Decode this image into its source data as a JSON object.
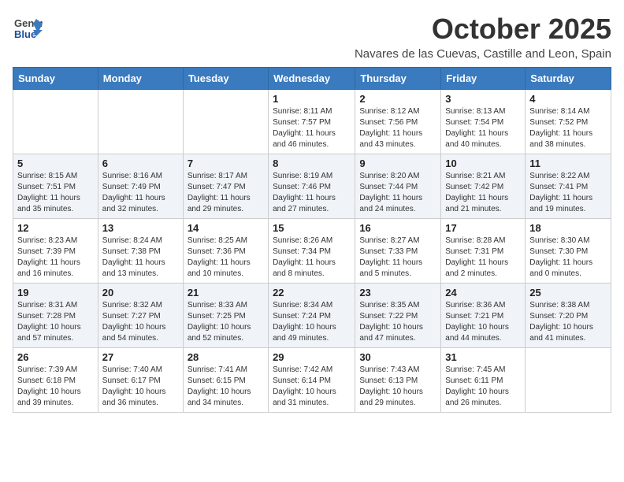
{
  "logo": {
    "general": "General",
    "blue": "Blue"
  },
  "title": "October 2025",
  "subtitle": "Navares de las Cuevas, Castille and Leon, Spain",
  "headers": [
    "Sunday",
    "Monday",
    "Tuesday",
    "Wednesday",
    "Thursday",
    "Friday",
    "Saturday"
  ],
  "weeks": [
    [
      {
        "day": "",
        "info": ""
      },
      {
        "day": "",
        "info": ""
      },
      {
        "day": "",
        "info": ""
      },
      {
        "day": "1",
        "info": "Sunrise: 8:11 AM\nSunset: 7:57 PM\nDaylight: 11 hours and 46 minutes."
      },
      {
        "day": "2",
        "info": "Sunrise: 8:12 AM\nSunset: 7:56 PM\nDaylight: 11 hours and 43 minutes."
      },
      {
        "day": "3",
        "info": "Sunrise: 8:13 AM\nSunset: 7:54 PM\nDaylight: 11 hours and 40 minutes."
      },
      {
        "day": "4",
        "info": "Sunrise: 8:14 AM\nSunset: 7:52 PM\nDaylight: 11 hours and 38 minutes."
      }
    ],
    [
      {
        "day": "5",
        "info": "Sunrise: 8:15 AM\nSunset: 7:51 PM\nDaylight: 11 hours and 35 minutes."
      },
      {
        "day": "6",
        "info": "Sunrise: 8:16 AM\nSunset: 7:49 PM\nDaylight: 11 hours and 32 minutes."
      },
      {
        "day": "7",
        "info": "Sunrise: 8:17 AM\nSunset: 7:47 PM\nDaylight: 11 hours and 29 minutes."
      },
      {
        "day": "8",
        "info": "Sunrise: 8:19 AM\nSunset: 7:46 PM\nDaylight: 11 hours and 27 minutes."
      },
      {
        "day": "9",
        "info": "Sunrise: 8:20 AM\nSunset: 7:44 PM\nDaylight: 11 hours and 24 minutes."
      },
      {
        "day": "10",
        "info": "Sunrise: 8:21 AM\nSunset: 7:42 PM\nDaylight: 11 hours and 21 minutes."
      },
      {
        "day": "11",
        "info": "Sunrise: 8:22 AM\nSunset: 7:41 PM\nDaylight: 11 hours and 19 minutes."
      }
    ],
    [
      {
        "day": "12",
        "info": "Sunrise: 8:23 AM\nSunset: 7:39 PM\nDaylight: 11 hours and 16 minutes."
      },
      {
        "day": "13",
        "info": "Sunrise: 8:24 AM\nSunset: 7:38 PM\nDaylight: 11 hours and 13 minutes."
      },
      {
        "day": "14",
        "info": "Sunrise: 8:25 AM\nSunset: 7:36 PM\nDaylight: 11 hours and 10 minutes."
      },
      {
        "day": "15",
        "info": "Sunrise: 8:26 AM\nSunset: 7:34 PM\nDaylight: 11 hours and 8 minutes."
      },
      {
        "day": "16",
        "info": "Sunrise: 8:27 AM\nSunset: 7:33 PM\nDaylight: 11 hours and 5 minutes."
      },
      {
        "day": "17",
        "info": "Sunrise: 8:28 AM\nSunset: 7:31 PM\nDaylight: 11 hours and 2 minutes."
      },
      {
        "day": "18",
        "info": "Sunrise: 8:30 AM\nSunset: 7:30 PM\nDaylight: 11 hours and 0 minutes."
      }
    ],
    [
      {
        "day": "19",
        "info": "Sunrise: 8:31 AM\nSunset: 7:28 PM\nDaylight: 10 hours and 57 minutes."
      },
      {
        "day": "20",
        "info": "Sunrise: 8:32 AM\nSunset: 7:27 PM\nDaylight: 10 hours and 54 minutes."
      },
      {
        "day": "21",
        "info": "Sunrise: 8:33 AM\nSunset: 7:25 PM\nDaylight: 10 hours and 52 minutes."
      },
      {
        "day": "22",
        "info": "Sunrise: 8:34 AM\nSunset: 7:24 PM\nDaylight: 10 hours and 49 minutes."
      },
      {
        "day": "23",
        "info": "Sunrise: 8:35 AM\nSunset: 7:22 PM\nDaylight: 10 hours and 47 minutes."
      },
      {
        "day": "24",
        "info": "Sunrise: 8:36 AM\nSunset: 7:21 PM\nDaylight: 10 hours and 44 minutes."
      },
      {
        "day": "25",
        "info": "Sunrise: 8:38 AM\nSunset: 7:20 PM\nDaylight: 10 hours and 41 minutes."
      }
    ],
    [
      {
        "day": "26",
        "info": "Sunrise: 7:39 AM\nSunset: 6:18 PM\nDaylight: 10 hours and 39 minutes."
      },
      {
        "day": "27",
        "info": "Sunrise: 7:40 AM\nSunset: 6:17 PM\nDaylight: 10 hours and 36 minutes."
      },
      {
        "day": "28",
        "info": "Sunrise: 7:41 AM\nSunset: 6:15 PM\nDaylight: 10 hours and 34 minutes."
      },
      {
        "day": "29",
        "info": "Sunrise: 7:42 AM\nSunset: 6:14 PM\nDaylight: 10 hours and 31 minutes."
      },
      {
        "day": "30",
        "info": "Sunrise: 7:43 AM\nSunset: 6:13 PM\nDaylight: 10 hours and 29 minutes."
      },
      {
        "day": "31",
        "info": "Sunrise: 7:45 AM\nSunset: 6:11 PM\nDaylight: 10 hours and 26 minutes."
      },
      {
        "day": "",
        "info": ""
      }
    ]
  ]
}
